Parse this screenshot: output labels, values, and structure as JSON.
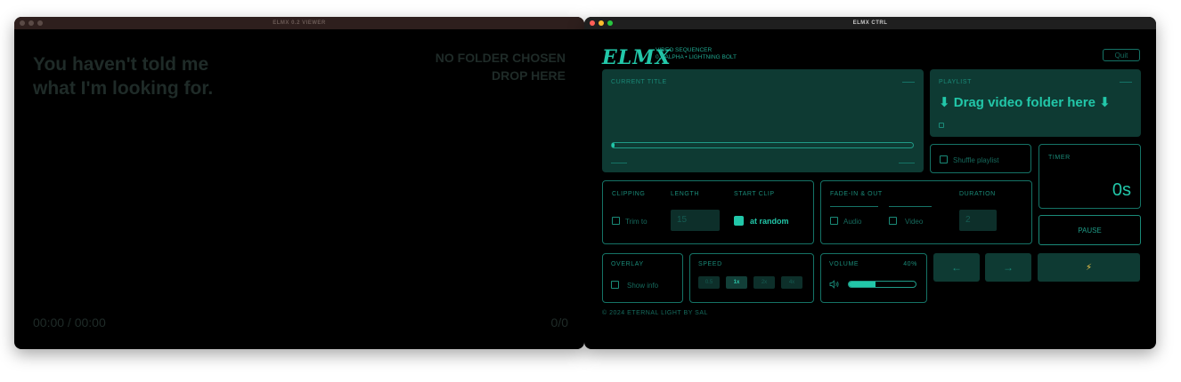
{
  "viewer": {
    "title": "ELMX 0.2 VIEWER",
    "message_line1": "You haven't told me",
    "message_line2": "what I'm looking for.",
    "folder_status": "NO FOLDER CHOSEN",
    "drop_hint": "DROP HERE",
    "timecode": "00:00 / 00:00",
    "counter": "0/0"
  },
  "ctrl": {
    "title": "ELMX CTRL",
    "logo": "ELMX",
    "subtitle_line1": "VIDEO SEQUENCER",
    "subtitle_line2": "0.2 ALPHA • LIGHTNING BOLT",
    "quit_label": "Quit",
    "current_title": {
      "label": "CURRENT TITLE",
      "progress": 0.01
    },
    "playlist": {
      "label": "PLAYLIST",
      "drag_text": "⬇ Drag video folder here ⬇"
    },
    "shuffle_label": "Shuffle playlist",
    "timer": {
      "label": "TIMER",
      "value": "0s"
    },
    "pause_label": "PAUSE",
    "clipping": {
      "label": "CLIPPING",
      "length_label": "LENGTH",
      "start_clip_label": "START CLIP",
      "trim_label": "Trim to",
      "length_value": "15",
      "at_random_label": "at random"
    },
    "fade": {
      "label": "FADE-IN & OUT",
      "duration_label": "DURATION",
      "audio_label": "Audio",
      "video_label": "Video",
      "duration_value": "2"
    },
    "overlay": {
      "label": "OVERLAY",
      "show_info_label": "Show info"
    },
    "speed": {
      "label": "SPEED",
      "options": [
        "0.5",
        "1x",
        "2x",
        "4x"
      ]
    },
    "volume": {
      "label": "VOLUME",
      "value_text": "40%",
      "level": 0.4,
      "icon": "speaker-icon"
    },
    "prev_label": "←",
    "next_label": "→",
    "bolt_label": "⚡",
    "footer": "© 2024 ETERNAL LIGHT BY SAL"
  },
  "colors": {
    "accent": "#22c7a9",
    "panel_fill": "#0e3a33",
    "border": "#157366",
    "dim_text": "#1f2b28"
  }
}
